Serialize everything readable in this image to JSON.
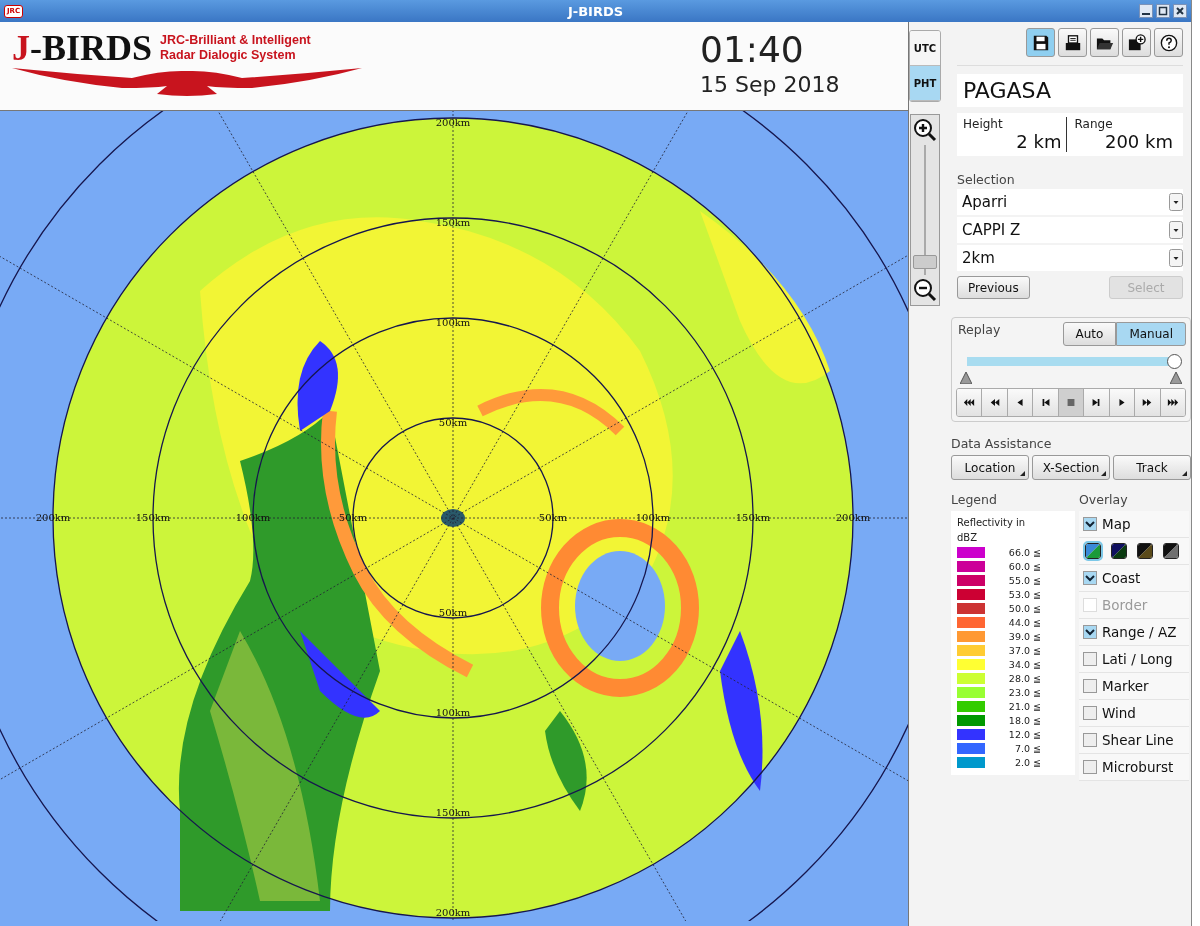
{
  "window": {
    "title": "J-BIRDS",
    "app_icon_text": "JRC"
  },
  "logo": {
    "initial": "J",
    "rest": "-BIRDS",
    "tagline": [
      "JRC-Brilliant & Intelligent",
      "Radar Dialogic System"
    ]
  },
  "clock": {
    "time": "01:40",
    "date": "15 Sep 2018"
  },
  "timezones": [
    {
      "label": "UTC",
      "selected": false
    },
    {
      "label": "PHT",
      "selected": true
    }
  ],
  "zoom": {
    "level": 0.05
  },
  "toolbar": [
    {
      "kind": "save",
      "selected": true
    },
    {
      "kind": "print",
      "selected": false
    },
    {
      "kind": "open",
      "selected": false
    },
    {
      "kind": "add",
      "selected": false
    },
    {
      "kind": "help",
      "selected": false
    }
  ],
  "station": {
    "name": "PAGASA",
    "height_label": "Height",
    "height_value": "2 km",
    "range_label": "Range",
    "range_value": "200 km"
  },
  "selection": {
    "label": "Selection",
    "dropdowns": [
      "Aparri",
      "CAPPI Z",
      "2km"
    ],
    "buttons": [
      {
        "label": "Previous",
        "disabled": false
      },
      {
        "label": "Select",
        "disabled": true
      }
    ]
  },
  "replay": {
    "label": "Replay",
    "modes": [
      {
        "label": "Auto",
        "selected": false
      },
      {
        "label": "Manual",
        "selected": true
      }
    ],
    "level": 1,
    "controls": [
      {
        "kind": "skip-first",
        "selected": false
      },
      {
        "kind": "rewind",
        "selected": false
      },
      {
        "kind": "back",
        "selected": false
      },
      {
        "kind": "step-back",
        "selected": false
      },
      {
        "kind": "stop",
        "selected": true
      },
      {
        "kind": "step-forward",
        "selected": false
      },
      {
        "kind": "play",
        "selected": false
      },
      {
        "kind": "fast-forward",
        "selected": false
      },
      {
        "kind": "skip-last",
        "selected": false
      }
    ]
  },
  "data_assistance": {
    "label": "Data Assistance",
    "buttons": [
      "Location",
      "X-Section",
      "Track"
    ]
  },
  "legend": {
    "label": "Legend",
    "title": "Reflectivity in dBZ",
    "items": [
      {
        "value": "66.0 ≦",
        "color": "#cc00cc"
      },
      {
        "value": "60.0 ≦",
        "color": "#cc0099"
      },
      {
        "value": "55.0 ≦",
        "color": "#cc0066"
      },
      {
        "value": "53.0 ≦",
        "color": "#cc0033"
      },
      {
        "value": "50.0 ≦",
        "color": "#cc3333"
      },
      {
        "value": "44.0 ≦",
        "color": "#ff6633"
      },
      {
        "value": "39.0 ≦",
        "color": "#ff9933"
      },
      {
        "value": "37.0 ≦",
        "color": "#ffcc33"
      },
      {
        "value": "34.0 ≦",
        "color": "#ffff33"
      },
      {
        "value": "28.0 ≦",
        "color": "#ccff33"
      },
      {
        "value": "23.0 ≦",
        "color": "#99ff33"
      },
      {
        "value": "21.0 ≦",
        "color": "#33cc00"
      },
      {
        "value": "18.0 ≦",
        "color": "#009900"
      },
      {
        "value": "12.0 ≦",
        "color": "#3333ff"
      },
      {
        "value": "7.0 ≦",
        "color": "#3366ff"
      },
      {
        "value": "2.0 ≦",
        "color": "#0099cc"
      }
    ]
  },
  "overlay": {
    "label": "Overlay",
    "items": [
      {
        "kind": "checkbox",
        "label": "Map",
        "checked": true,
        "disabled": false
      },
      {
        "kind": "swatches",
        "options": [
          {
            "halves": [
              {
                "color": "#3a8ad8"
              },
              {
                "color": "#1a9a3a"
              }
            ],
            "selected": true
          },
          {
            "halves": [
              {
                "color": "#101060"
              },
              {
                "color": "#0a3a10"
              }
            ],
            "selected": false
          },
          {
            "halves": [
              {
                "color": "#101010"
              },
              {
                "color": "#5a4a1a"
              }
            ],
            "selected": false
          },
          {
            "halves": [
              {
                "color": "#101010"
              },
              {
                "color": "#707070"
              }
            ],
            "selected": false
          }
        ]
      },
      {
        "kind": "checkbox",
        "label": "Coast",
        "checked": true,
        "disabled": false
      },
      {
        "kind": "checkbox",
        "label": "Border",
        "checked": false,
        "disabled": true
      },
      {
        "kind": "checkbox",
        "label": "Range / AZ",
        "checked": true,
        "disabled": false
      },
      {
        "kind": "checkbox",
        "label": "Lati / Long",
        "checked": false,
        "disabled": false
      },
      {
        "kind": "checkbox",
        "label": "Marker",
        "checked": false,
        "disabled": false
      },
      {
        "kind": "checkbox",
        "label": "Wind",
        "checked": false,
        "disabled": false
      },
      {
        "kind": "checkbox",
        "label": "Shear Line",
        "checked": false,
        "disabled": false
      },
      {
        "kind": "checkbox",
        "label": "Microburst",
        "checked": false,
        "disabled": false
      }
    ]
  },
  "map": {
    "range_labels": {
      "top": [
        "200km",
        "150km",
        "100km",
        "50km"
      ],
      "middle": [
        "200km",
        "150km",
        "100km",
        "50km",
        "50km",
        "100km",
        "150km",
        "200km"
      ],
      "bottom": [
        "50km",
        "100km",
        "150km",
        "200km"
      ]
    }
  }
}
